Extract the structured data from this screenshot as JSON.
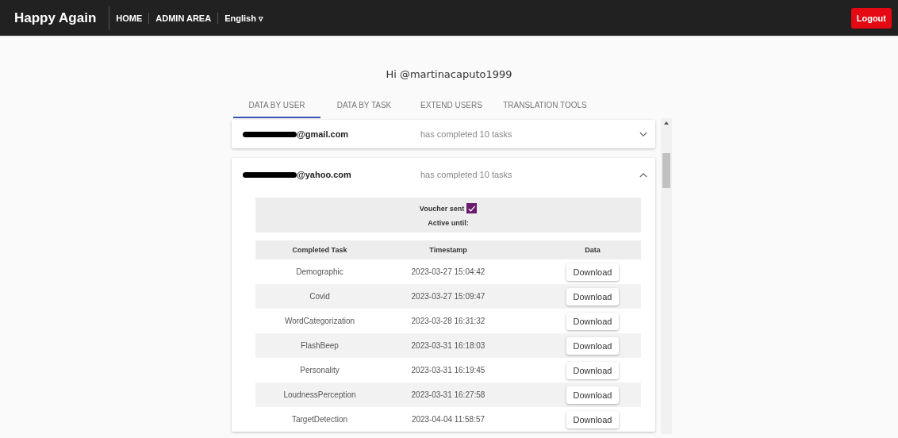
{
  "navbar": {
    "brand": "Happy Again",
    "links": [
      {
        "label": "HOME"
      },
      {
        "label": "ADMIN AREA"
      },
      {
        "label": "English ▿"
      }
    ],
    "logout": "Logout"
  },
  "greeting": "Hi @martinacaputo1999",
  "tabs": [
    {
      "label": "DATA BY USER",
      "selected": true
    },
    {
      "label": "DATA BY TASK",
      "selected": false
    },
    {
      "label": "EXTEND USERS",
      "selected": false
    },
    {
      "label": "TRANSLATION TOOLS",
      "selected": false
    }
  ],
  "users": [
    {
      "email": "@gmail.com",
      "summary": "has completed 10 tasks",
      "expanded": false
    },
    {
      "email": "@yahoo.com",
      "summary": "has completed 10 tasks",
      "expanded": true,
      "voucher": {
        "label": "Voucher sent",
        "checked": true,
        "active_until": "Active until:"
      },
      "table": {
        "columns": [
          "Completed Task",
          "Timestamp",
          "Data"
        ],
        "rows": [
          {
            "task": "Demographic",
            "timestamp": "2023-03-27 15:04:42",
            "action": "Download"
          },
          {
            "task": "Covid",
            "timestamp": "2023-03-27 15:09:47",
            "action": "Download"
          },
          {
            "task": "WordCategorization",
            "timestamp": "2023-03-28 16:31:32",
            "action": "Download"
          },
          {
            "task": "FlashBeep",
            "timestamp": "2023-03-31 16:18:03",
            "action": "Download"
          },
          {
            "task": "Personality",
            "timestamp": "2023-03-31 16:19:45",
            "action": "Download"
          },
          {
            "task": "LoudnessPerception",
            "timestamp": "2023-03-31 16:27:58",
            "action": "Download"
          },
          {
            "task": "TargetDetection",
            "timestamp": "2023-04-04 11:58:57",
            "action": "Download"
          }
        ]
      }
    }
  ]
}
